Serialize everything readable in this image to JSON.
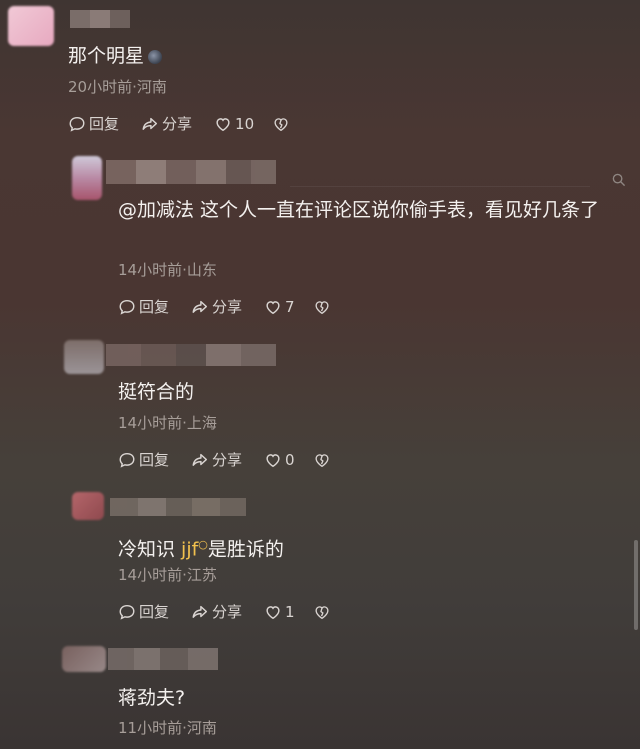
{
  "colors": {
    "accent": "#f2c14e",
    "text": "#f4f1ef",
    "meta": "#a79e99"
  },
  "comments": [
    {
      "text": "那个明星",
      "meta": "20小时前·河南",
      "reply": "回复",
      "share": "分享",
      "likes": "10"
    },
    {
      "text": "@加减法 这个人一直在评论区说你偷手表，看见好几条了",
      "meta": "14小时前·山东",
      "reply": "回复",
      "share": "分享",
      "likes": "7"
    },
    {
      "text": "挺符合的",
      "meta": "14小时前·上海",
      "reply": "回复",
      "share": "分享",
      "likes": "0"
    },
    {
      "text_before": "冷知识 ",
      "text_highlight": "jjf",
      "text_after": "是胜诉的",
      "meta": "14小时前·江苏",
      "reply": "回复",
      "share": "分享",
      "likes": "1"
    },
    {
      "text": "蒋劲夫?",
      "meta": "11小时前·河南"
    }
  ],
  "icons": [
    "reply-icon",
    "share-icon",
    "like-icon",
    "dislike-icon",
    "search-icon"
  ]
}
